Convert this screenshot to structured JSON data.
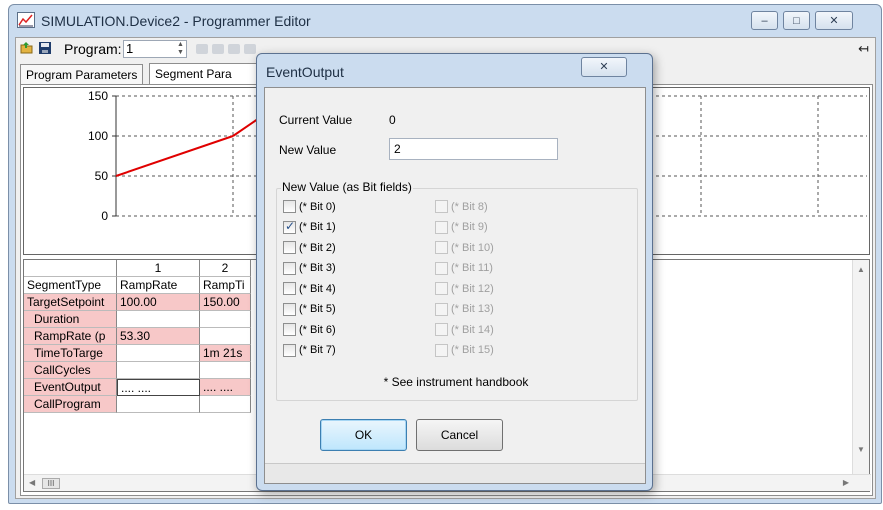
{
  "window": {
    "title": "SIMULATION.Device2 - Programmer Editor",
    "min_glyph": "–",
    "max_glyph": "□",
    "close_glyph": "✕"
  },
  "toolbar": {
    "program_label": "Program:",
    "program_value": "1",
    "pin_glyph": "↤"
  },
  "tabs": [
    {
      "label": "Program Parameters"
    },
    {
      "label": "Segment Para"
    }
  ],
  "chart_data": {
    "type": "line",
    "title": "",
    "xlabel": "",
    "ylabel": "",
    "ylim": [
      0,
      150
    ],
    "yticks": [
      "150",
      "100",
      "50",
      "0"
    ],
    "grid": true,
    "series": [
      {
        "color": "#e00000",
        "x": [
          0,
          1
        ],
        "y": [
          50,
          100
        ]
      },
      {
        "color": "#e00000",
        "x": [
          1,
          1.5
        ],
        "y": [
          100,
          150
        ]
      }
    ]
  },
  "grid": {
    "col_headers": [
      "1",
      "2"
    ],
    "rows": [
      {
        "label": "SegmentType",
        "c1": "RampRate",
        "c2": "RampTi",
        "pink_label": false,
        "pink1": false,
        "pink2": false,
        "dropdown": true
      },
      {
        "label": "TargetSetpoint",
        "c1": "100.00",
        "c2": "150.00",
        "pink_label": true,
        "pink1": true,
        "pink2": true
      },
      {
        "label": "Duration",
        "c1": "",
        "c2": "",
        "pink_label": true,
        "pink1": false,
        "pink2": false
      },
      {
        "label": "RampRate (p",
        "c1": "53.30",
        "c2": "",
        "pink_label": true,
        "pink1": true,
        "pink2": false
      },
      {
        "label": "TimeToTarge",
        "c1": "",
        "c2": "1m 21s",
        "pink_label": true,
        "pink1": false,
        "pink2": true
      },
      {
        "label": "CallCycles",
        "c1": "",
        "c2": "",
        "pink_label": true,
        "pink1": false,
        "pink2": false
      },
      {
        "label": "EventOutput",
        "c1": ".... ....",
        "c2": ".... ....",
        "pink_label": true,
        "pink1": false,
        "pink2": true,
        "edit": true
      },
      {
        "label": "CallProgram",
        "c1": "",
        "c2": "",
        "pink_label": true,
        "pink1": false,
        "pink2": false
      }
    ],
    "dropdown_glyph": "▾",
    "ellipsis_glyph": "...",
    "scroll_left": "◀",
    "scroll_right": "▶",
    "scroll_up": "▲",
    "scroll_down": "▼",
    "thumb_glyph": "III"
  },
  "dialog": {
    "title": "EventOutput",
    "close_glyph": "✕",
    "current_value_label": "Current Value",
    "current_value": "0",
    "new_value_label": "New Value",
    "new_value": "2",
    "bitfields_label": "New Value (as Bit fields)",
    "bits_left": [
      {
        "label": "(* Bit 0)",
        "checked": false
      },
      {
        "label": "(* Bit 1)",
        "checked": true
      },
      {
        "label": "(* Bit 2)",
        "checked": false
      },
      {
        "label": "(* Bit 3)",
        "checked": false
      },
      {
        "label": "(* Bit 4)",
        "checked": false
      },
      {
        "label": "(* Bit 5)",
        "checked": false
      },
      {
        "label": "(* Bit 6)",
        "checked": false
      },
      {
        "label": "(* Bit 7)",
        "checked": false
      }
    ],
    "bits_right": [
      {
        "label": "(* Bit 8)"
      },
      {
        "label": "(* Bit 9)"
      },
      {
        "label": "(* Bit 10)"
      },
      {
        "label": "(* Bit 11)"
      },
      {
        "label": "(* Bit 12)"
      },
      {
        "label": "(* Bit 13)"
      },
      {
        "label": "(* Bit 14)"
      },
      {
        "label": "(* Bit 15)"
      }
    ],
    "note": "* See instrument handbook",
    "ok_label": "OK",
    "cancel_label": "Cancel"
  }
}
